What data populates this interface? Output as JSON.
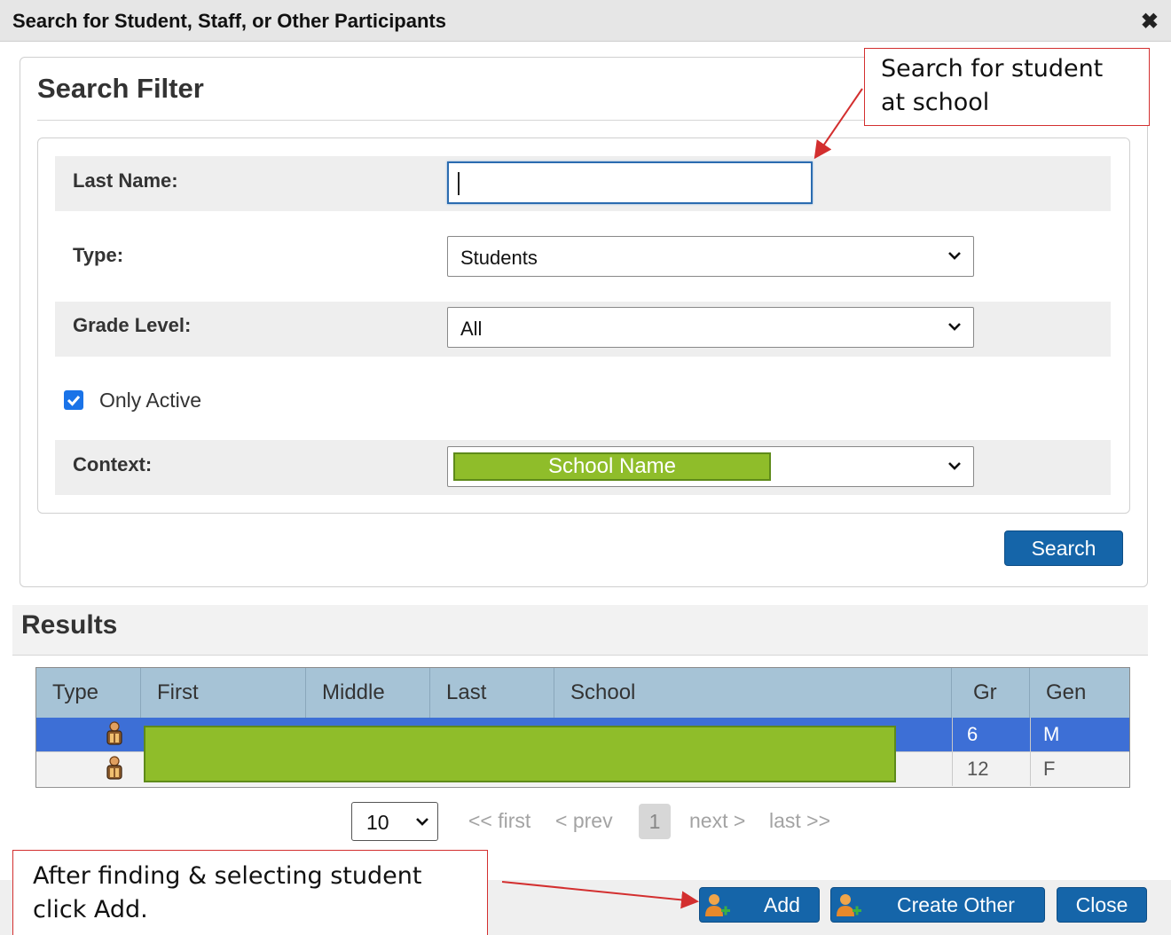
{
  "dialog": {
    "title": "Search for Student, Staff, or Other Participants",
    "close_glyph": "✖"
  },
  "search_filter": {
    "heading": "Search Filter",
    "last_name": {
      "label": "Last Name:",
      "value": ""
    },
    "type": {
      "label": "Type:",
      "selected": "Students"
    },
    "grade_level": {
      "label": "Grade Level:",
      "selected": "All"
    },
    "only_active": {
      "label": "Only Active",
      "checked": true
    },
    "context": {
      "label": "Context:",
      "selected": "School Name"
    },
    "search_button": "Search"
  },
  "results": {
    "heading": "Results",
    "columns": [
      "Type",
      "First",
      "Middle",
      "Last",
      "School",
      "Gr",
      "Gen"
    ],
    "rows": [
      {
        "type_icon": "student-icon",
        "gr": "6",
        "gen": "M",
        "selected": true
      },
      {
        "type_icon": "student-icon",
        "gr": "12",
        "gen": "F",
        "selected": false
      }
    ]
  },
  "pagination": {
    "page_size": "10",
    "first": "<< first",
    "prev": "< prev",
    "current": "1",
    "next": "next >",
    "last": "last >>"
  },
  "footer": {
    "add_label": "Add",
    "create_other_label": "Create Other",
    "close_label": "Close",
    "add_icon": "add-person-icon"
  },
  "annotations": {
    "top_callout": "Search for student at school",
    "bottom_callout": "After finding & selecting student click Add.",
    "color": "#d32f2f"
  },
  "colors": {
    "primary_button": "#1565a9",
    "selected_row": "#3d6fd6",
    "header_row": "#a6c3d6",
    "redaction": "#8fbd2a"
  }
}
